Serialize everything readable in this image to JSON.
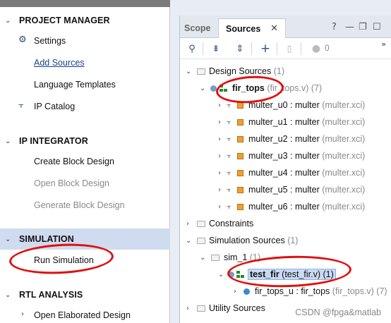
{
  "flow_navigator": {
    "sections": [
      {
        "title": "PROJECT MANAGER",
        "expanded": true,
        "items": [
          {
            "label": "Settings",
            "icon": "gear-icon"
          },
          {
            "label": "Add Sources",
            "style": "link"
          },
          {
            "label": "Language Templates"
          },
          {
            "label": "IP Catalog",
            "icon": "ip-plug-icon"
          }
        ]
      },
      {
        "title": "IP INTEGRATOR",
        "expanded": true,
        "items": [
          {
            "label": "Create Block Design"
          },
          {
            "label": "Open Block Design",
            "disabled": true
          },
          {
            "label": "Generate Block Design",
            "disabled": true
          }
        ]
      },
      {
        "title": "SIMULATION",
        "expanded": true,
        "active": true,
        "items": [
          {
            "label": "Run Simulation"
          }
        ]
      },
      {
        "title": "RTL ANALYSIS",
        "expanded": true,
        "items": [
          {
            "label": "Open Elaborated Design",
            "has_arrow": true
          }
        ]
      }
    ]
  },
  "sources_panel": {
    "tabs": [
      {
        "label": "Scope"
      },
      {
        "label": "Sources",
        "active": true
      }
    ],
    "close_glyph": "✕",
    "window_buttons": {
      "help": "?",
      "minimize": "—",
      "restore": "❐",
      "maximize": "☐"
    },
    "toolbar": {
      "count": "0",
      "more": "»"
    },
    "tree": [
      {
        "label": "Design Sources",
        "count": "(1)"
      },
      {
        "label": "fir_tops",
        "suffix": "(fir_tops.v) (7)"
      },
      {
        "label": "multer_u0 : multer",
        "suffix": "(multer.xci)"
      },
      {
        "label": "multer_u1 : multer",
        "suffix": "(multer.xci)"
      },
      {
        "label": "multer_u2 : multer",
        "suffix": "(multer.xci)"
      },
      {
        "label": "multer_u3 : multer",
        "suffix": "(multer.xci)"
      },
      {
        "label": "multer_u4 : multer",
        "suffix": "(multer.xci)"
      },
      {
        "label": "multer_u5 : multer",
        "suffix": "(multer.xci)"
      },
      {
        "label": "multer_u6 : multer",
        "suffix": "(multer.xci)"
      },
      {
        "label": "Constraints",
        "count": ""
      },
      {
        "label": "Simulation Sources",
        "count": "(1)"
      },
      {
        "label": "sim_1",
        "count": "(1)"
      },
      {
        "label": "test_fir",
        "suffix": "(test_fir.v) (1)"
      },
      {
        "label": "fir_tops_u : fir_tops",
        "suffix": "(fir_tops.v) (7)"
      },
      {
        "label": "Utility Sources",
        "count": ""
      }
    ]
  },
  "watermark": "CSDN @fpga&matlab",
  "colors": {
    "annotation_red": "#e01010",
    "active_section": "#cfdcef",
    "link": "#1a3f8c"
  }
}
